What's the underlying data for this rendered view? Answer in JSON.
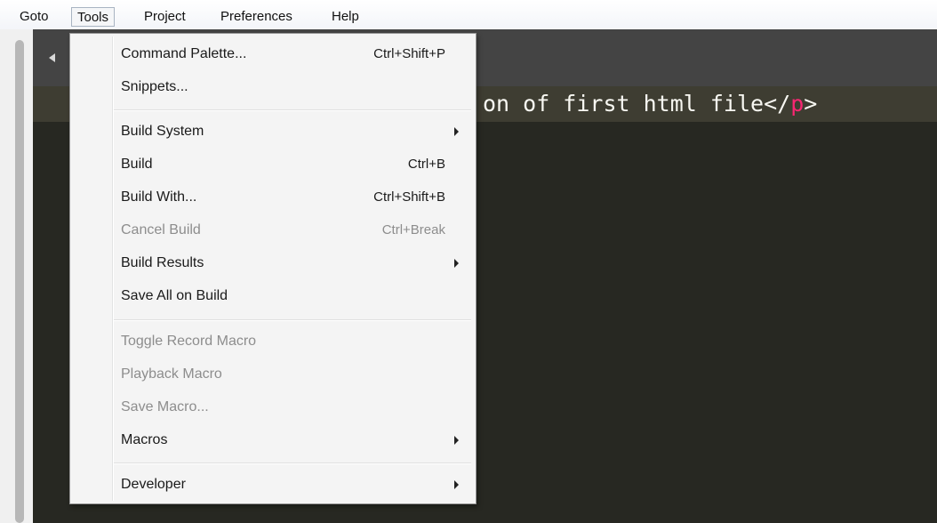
{
  "menubar": {
    "items": [
      "Goto",
      "Tools",
      "Project",
      "Preferences",
      "Help"
    ],
    "active": "Tools"
  },
  "editor": {
    "code_text": "on of first html file</",
    "code_tag": "p",
    "code_close": ">"
  },
  "tools_menu": {
    "items": [
      {
        "label": "Command Palette...",
        "shortcut": "Ctrl+Shift+P",
        "enabled": true,
        "submenu": false
      },
      {
        "label": "Snippets...",
        "shortcut": "",
        "enabled": true,
        "submenu": false
      },
      {
        "label": "Build System",
        "shortcut": "",
        "enabled": true,
        "submenu": true
      },
      {
        "label": "Build",
        "shortcut": "Ctrl+B",
        "enabled": true,
        "submenu": false
      },
      {
        "label": "Build With...",
        "shortcut": "Ctrl+Shift+B",
        "enabled": true,
        "submenu": false
      },
      {
        "label": "Cancel Build",
        "shortcut": "Ctrl+Break",
        "enabled": false,
        "submenu": false
      },
      {
        "label": "Build Results",
        "shortcut": "",
        "enabled": true,
        "submenu": true
      },
      {
        "label": "Save All on Build",
        "shortcut": "",
        "enabled": true,
        "submenu": false
      },
      {
        "label": "Toggle Record Macro",
        "shortcut": "",
        "enabled": false,
        "submenu": false
      },
      {
        "label": "Playback Macro",
        "shortcut": "",
        "enabled": false,
        "submenu": false
      },
      {
        "label": "Save Macro...",
        "shortcut": "",
        "enabled": false,
        "submenu": false
      },
      {
        "label": "Macros",
        "shortcut": "",
        "enabled": true,
        "submenu": true
      },
      {
        "label": "Developer",
        "shortcut": "",
        "enabled": true,
        "submenu": true
      }
    ]
  },
  "icons": {
    "tab_scroll_left": "chevron-left-icon",
    "submenu_arrow": "chevron-right-icon"
  },
  "colors": {
    "editor_bg": "#272822",
    "tag_color": "#f92672",
    "menu_bg": "#f4f4f4",
    "disabled_text": "#8d8d8d"
  }
}
